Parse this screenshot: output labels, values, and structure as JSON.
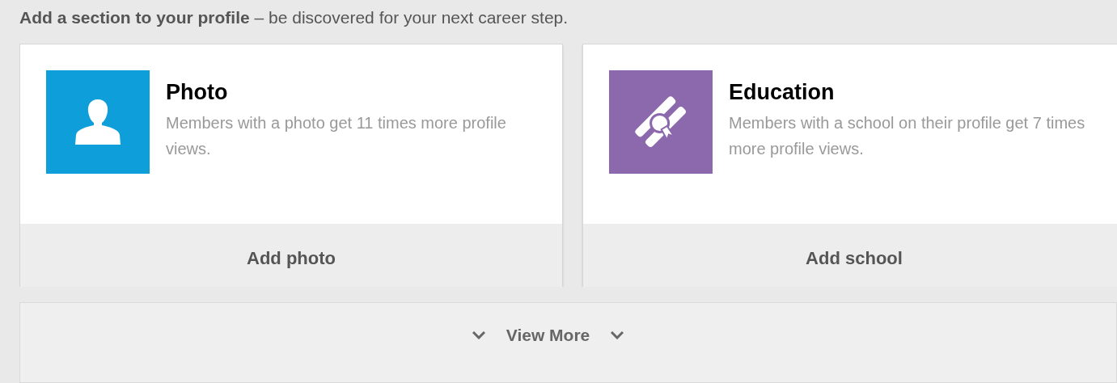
{
  "heading": "**Add a section to your profile** – be discovered for your next career step.",
  "cards": [
    {
      "kind": "photo",
      "color": "#0e9fdb",
      "title": "Photo",
      "description": "Members with a photo get 11 times more profile views.",
      "action": "Add photo"
    },
    {
      "kind": "education",
      "color": "#8c68ad",
      "title": "Education",
      "description": "Members with a school on their profile get 7 times more profile views.",
      "action": "Add school"
    }
  ],
  "view_more": "View More"
}
